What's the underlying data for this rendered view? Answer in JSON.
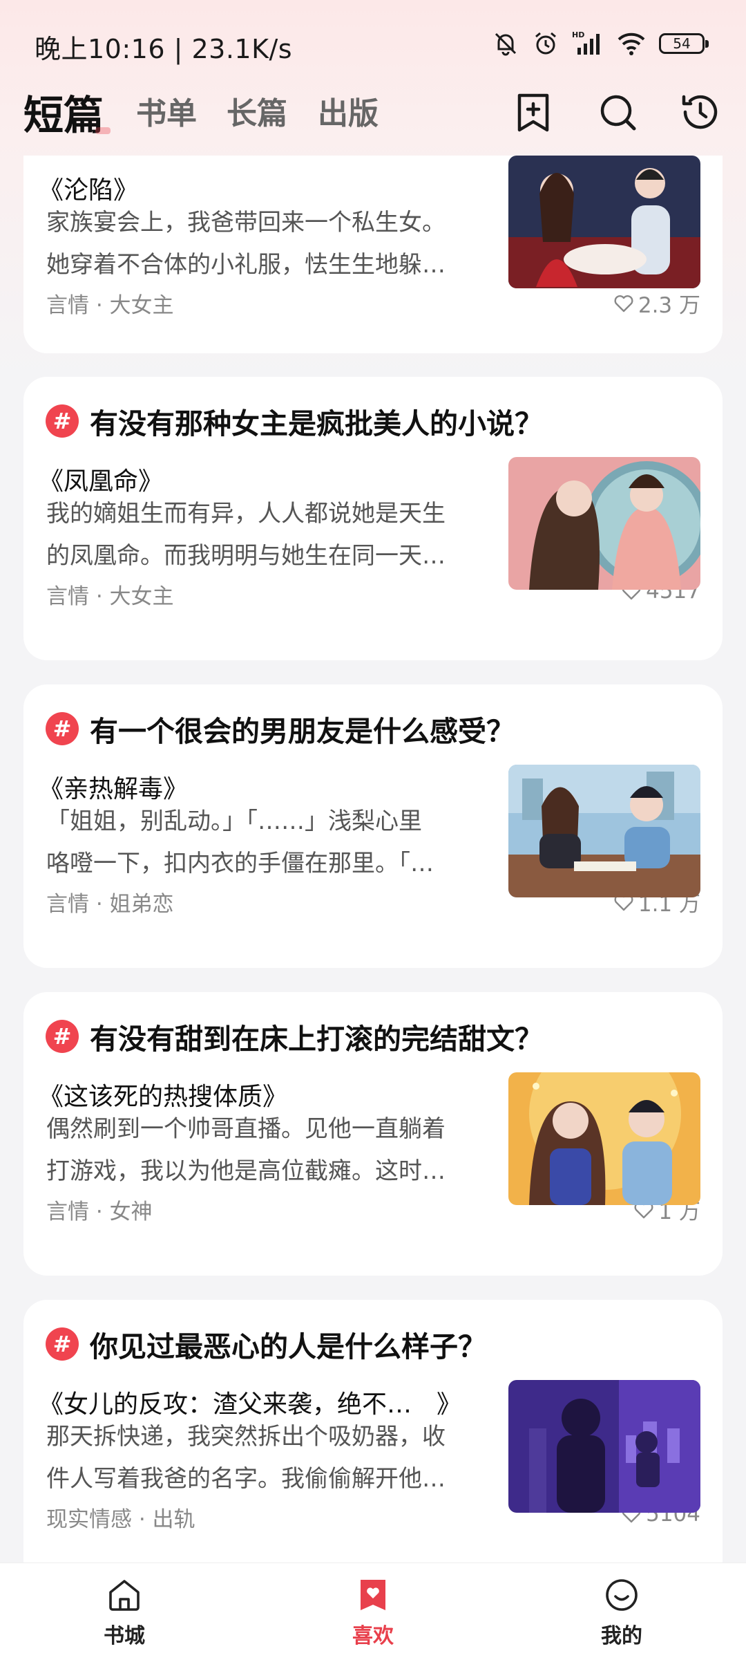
{
  "status_bar": {
    "time": "晚上10:16 | 23.1K/s",
    "battery": "54"
  },
  "header": {
    "tabs": [
      {
        "label": "短篇",
        "active": true
      },
      {
        "label": "书单",
        "active": false
      },
      {
        "label": "长篇",
        "active": false
      },
      {
        "label": "出版",
        "active": false
      }
    ],
    "icons": [
      "add-bookshelf-icon",
      "search-icon",
      "history-icon"
    ]
  },
  "feed": {
    "partial_card": {
      "book": "《沦陷》",
      "excerpt_lines": [
        "家族宴会上，我爸带回来一个私生女。",
        "她穿着不合体的小礼服，怯生生地躲…"
      ],
      "tags": "言情 · 大女主",
      "likes": "2.3 万"
    },
    "cards": [
      {
        "question": "有没有那种女主是疯批美人的小说？",
        "book": "《凤凰命》",
        "excerpt_lines": [
          "我的嫡姐生而有异，人人都说她是天生",
          "的凤凰命。而我明明与她生在同一天…"
        ],
        "tags": "言情 · 大女主",
        "likes": "4517"
      },
      {
        "question": "有一个很会的男朋友是什么感受？",
        "book": "《亲热解毒》",
        "excerpt_lines": [
          "「姐姐，别乱动。」「……」浅梨心里",
          "咯噔一下，扣内衣的手僵在那里。「…"
        ],
        "tags": "言情 · 姐弟恋",
        "likes": "1.1 万"
      },
      {
        "question": "有没有甜到在床上打滚的完结甜文？",
        "book": "《这该死的热搜体质》",
        "excerpt_lines": [
          "偶然刷到一个帅哥直播。见他一直躺着",
          "打游戏，我以为他是高位截瘫。这时…"
        ],
        "tags": "言情 · 女神",
        "likes": "1 万"
      },
      {
        "question": "你见过最恶心的人是什么样子？",
        "book": "《女儿的反攻：渣父来袭，绝不…　》",
        "excerpt_lines": [
          "那天拆快递，我突然拆出个吸奶器，收",
          "件人写着我爸的名字。我偷偷解开他…"
        ],
        "tags": "现实情感 · 出轨",
        "likes": "5104"
      }
    ]
  },
  "bottom_nav": {
    "items": [
      {
        "label": "书城",
        "icon": "home-icon",
        "active": false
      },
      {
        "label": "喜欢",
        "icon": "heart-bookmark-icon",
        "active": true
      },
      {
        "label": "我的",
        "icon": "profile-smile-icon",
        "active": false
      }
    ]
  },
  "colors": {
    "accent": "#e8404c",
    "hash_badge": "#f0444f",
    "background": "#f4f4f6"
  }
}
